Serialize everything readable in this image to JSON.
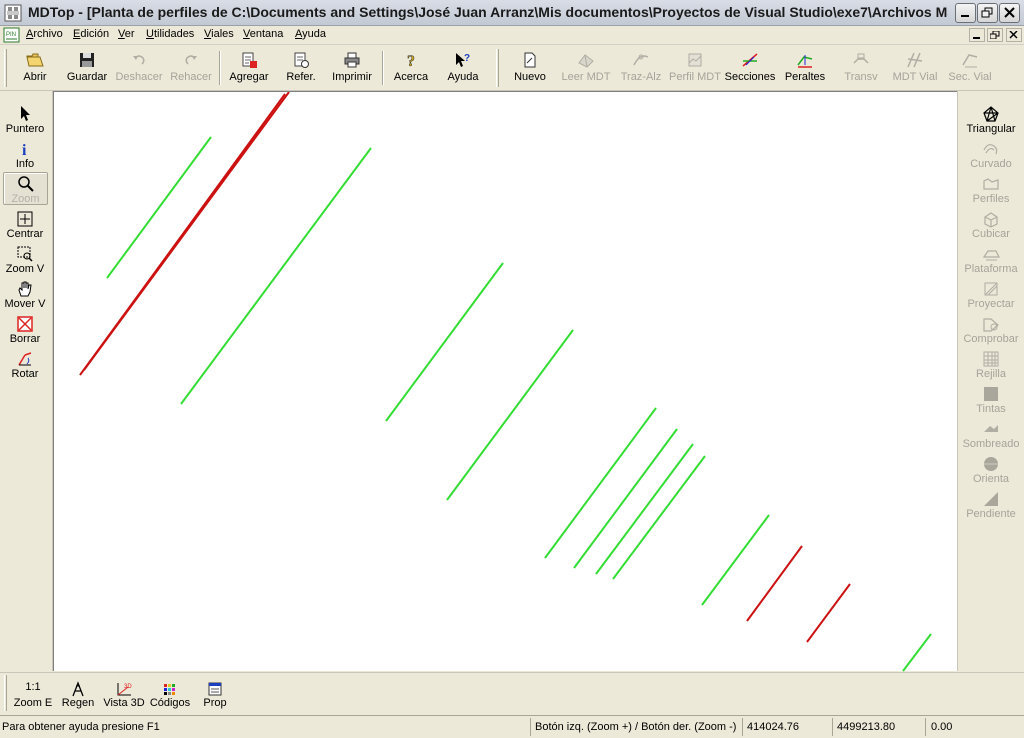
{
  "window": {
    "title": "MDTop - [Planta de perfiles de C:\\Documents and Settings\\José Juan Arranz\\Mis documentos\\Proyectos de Visual Studio\\exe7\\Archivos MSI Ejemplo..."
  },
  "menu": {
    "items": [
      "Archivo",
      "Edición",
      "Ver",
      "Utilidades",
      "Viales",
      "Ventana",
      "Ayuda"
    ]
  },
  "toolbar": {
    "abrir": "Abrir",
    "guardar": "Guardar",
    "deshacer": "Deshacer",
    "rehacer": "Rehacer",
    "agregar": "Agregar",
    "refer": "Refer.",
    "imprimir": "Imprimir",
    "acerca": "Acerca",
    "ayuda": "Ayuda",
    "nuevo": "Nuevo",
    "leer_mdt": "Leer MDT",
    "traz_alz": "Traz-Alz",
    "perfil_mdt": "Perfil MDT",
    "secciones": "Secciones",
    "peraltes": "Peraltes",
    "transv": "Transv",
    "mdt_vial": "MDT Vial",
    "sec_vial": "Sec. Vial"
  },
  "left_tools": [
    "Puntero",
    "Info",
    "Zoom",
    "Centrar",
    "Zoom V",
    "Mover V",
    "Borrar",
    "Rotar"
  ],
  "right_tools": [
    "Triangular",
    "Curvado",
    "Perfiles",
    "Cubicar",
    "Plataforma",
    "Proyectar",
    "Comprobar",
    "Rejilla",
    "Tintas",
    "Sombreado",
    "Orienta",
    "Pendiente"
  ],
  "bottom_tools": {
    "zoom_e_icon_text": "1:1",
    "zoom_e": "Zoom E",
    "regen": "Regen",
    "vista3d": "Vista 3D",
    "codigos": "Códigos",
    "prop": "Prop"
  },
  "status": {
    "help": "Para obtener ayuda presione F1",
    "mouse_hint": "Botón izq. (Zoom +) / Botón der. (Zoom -)",
    "coord_x": "414024.76",
    "coord_y": "4499213.80",
    "coord_z": "0.00"
  },
  "colors": {
    "green_line": "#33dd33",
    "red_line": "#cc1111"
  }
}
